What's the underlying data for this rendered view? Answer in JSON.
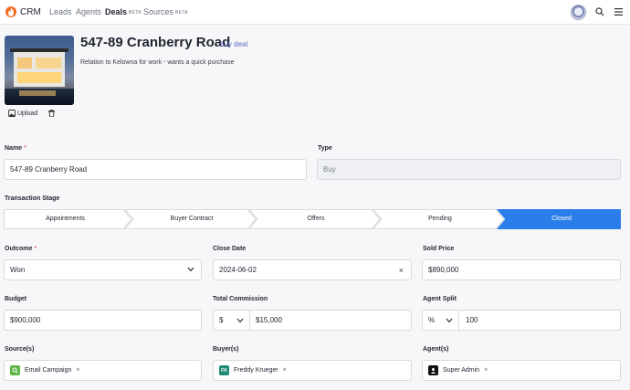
{
  "nav": {
    "brand": "CRM",
    "items": [
      {
        "label": "Leads",
        "active": false,
        "beta": ""
      },
      {
        "label": "Agents",
        "active": false,
        "beta": ""
      },
      {
        "label": "Deals",
        "active": true,
        "beta": "BETA"
      },
      {
        "label": "Sources",
        "active": false,
        "beta": "BETA"
      }
    ]
  },
  "deal": {
    "title": "547-89 Cranberry Road",
    "tag": "buy deal",
    "description": "Relation to Kelowna for work - wants a quick purchase",
    "upload_label": "Upload"
  },
  "form": {
    "name_label": "Name",
    "name_required": "*",
    "name_value": "547-89 Cranberry Road",
    "type_label": "Type",
    "type_value": "Buy",
    "stage_label": "Transaction Stage",
    "stages": [
      "Appointments",
      "Buyer Contract",
      "Offers",
      "Pending",
      "Closed"
    ],
    "active_stage": 4,
    "outcome_label": "Outcome",
    "outcome_required": "*",
    "outcome_value": "Won",
    "close_date_label": "Close Date",
    "close_date_value": "2024-06-02",
    "sold_price_label": "Sold Price",
    "sold_price_value": "$890,000",
    "budget_label": "Budget",
    "budget_value": "$900,000",
    "commission_label": "Total Commission",
    "commission_unit": "$",
    "commission_value": "$15,000",
    "split_label": "Agent Split",
    "split_unit": "%",
    "split_value": "100",
    "sources_label": "Source(s)",
    "source_chip": "Email Campaign",
    "buyers_label": "Buyer(s)",
    "buyer_chip": "Freddy Krueger",
    "buyer_initials": "FK",
    "agents_label": "Agent(s)",
    "agent_chip": "Super Admin",
    "clear_glyph": "×",
    "chip_remove": "×"
  },
  "colors": {
    "accent": "#2b7de9",
    "brand": "#f26b21",
    "source_icon": "#5fb548",
    "buyer_icon": "#1f8a74",
    "agent_icon": "#111111"
  },
  "icons": {
    "logo": "flame-icon",
    "search": "search-icon",
    "menu": "hamburger-icon",
    "upload": "image-icon",
    "delete": "trash-icon",
    "dropdown": "chevron-down-icon"
  }
}
